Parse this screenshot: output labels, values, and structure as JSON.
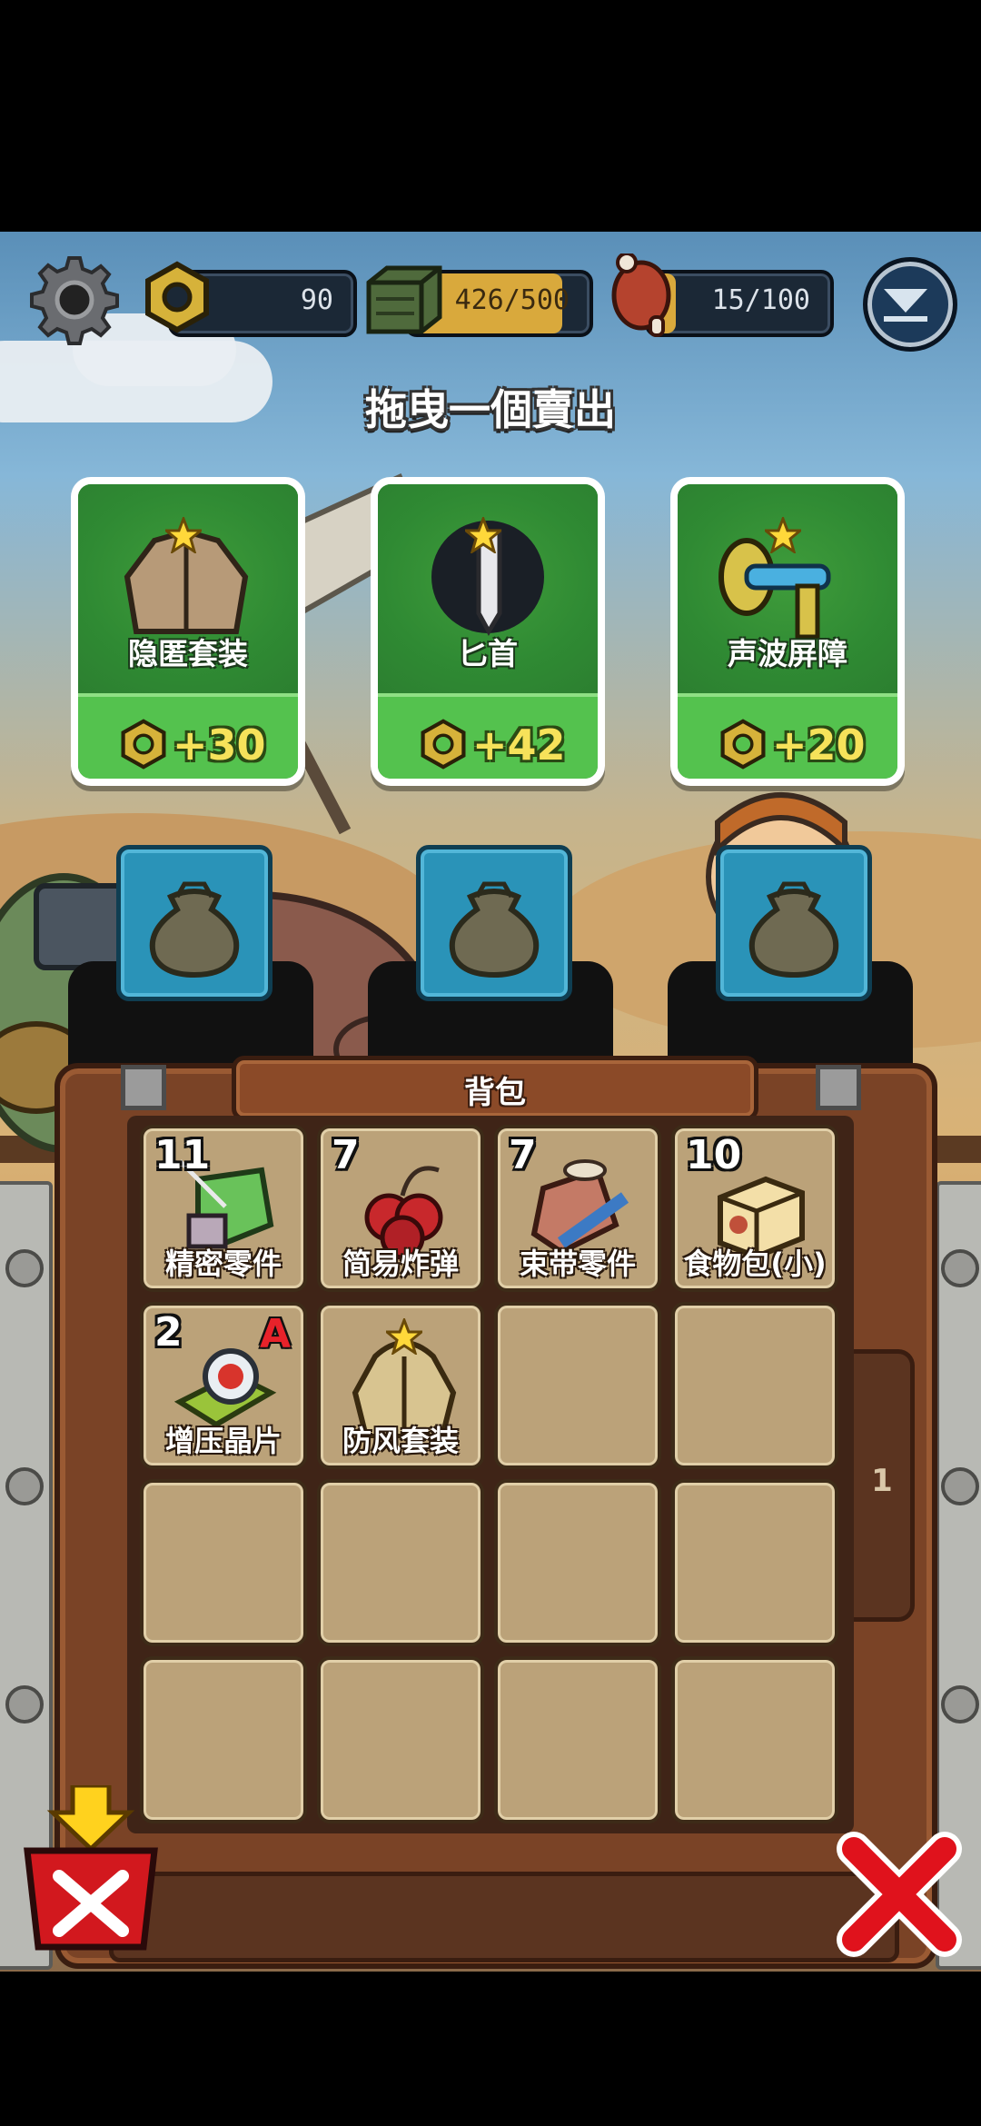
{
  "topbar": {
    "nuts_value": "90",
    "cargo_value": "426/500",
    "cargo_fill": 0.852,
    "food_value": "15/100",
    "food_fill": 0.15
  },
  "instruction": "拖曳一個賣出",
  "sell_cards": [
    {
      "name": "隐匿套装",
      "price": "+30"
    },
    {
      "name": "匕首",
      "price": "+42"
    },
    {
      "name": "声波屏障",
      "price": "+20"
    }
  ],
  "backpack": {
    "title": "背包",
    "page": "1",
    "items": [
      {
        "count": "11",
        "name": "精密零件",
        "rank": ""
      },
      {
        "count": "7",
        "name": "简易炸弹",
        "rank": ""
      },
      {
        "count": "7",
        "name": "束带零件",
        "rank": ""
      },
      {
        "count": "10",
        "name": "食物包(小)",
        "rank": ""
      },
      {
        "count": "2",
        "name": "增压晶片",
        "rank": "A"
      },
      {
        "count": "",
        "name": "防风套装",
        "rank": ""
      }
    ]
  },
  "colors": {
    "card_green": "#3f8f3c",
    "price_yellow": "#f6e25a",
    "panel_brown": "#7a4326",
    "slot_tan": "#bba279",
    "close_red": "#e0121c"
  },
  "icons": [
    "gear-icon",
    "nut-icon",
    "cargo-crate-icon",
    "meat-icon",
    "dropdown-icon",
    "star-icon",
    "sack-icon",
    "discard-icon",
    "close-icon"
  ]
}
